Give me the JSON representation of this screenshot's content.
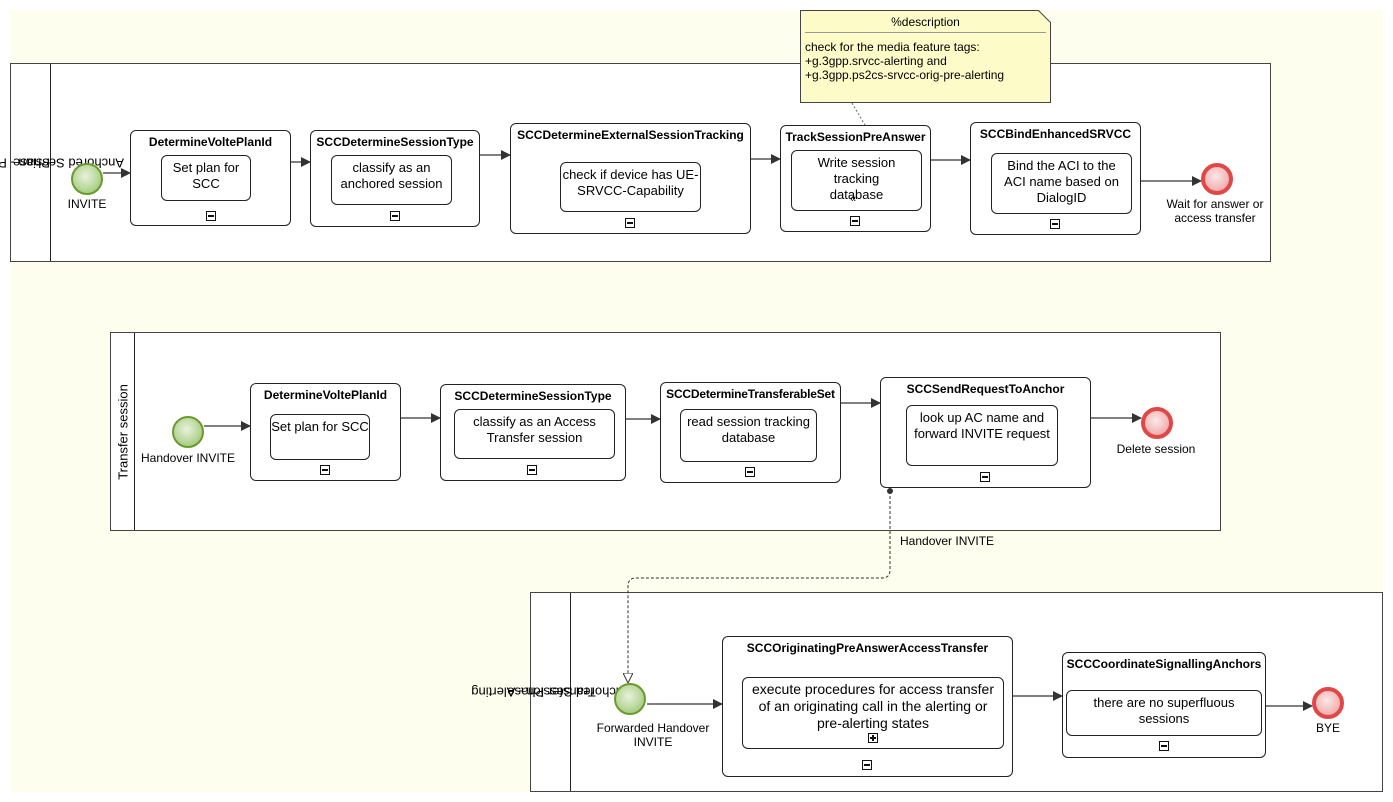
{
  "diagram": {
    "type": "BPMN process diagram",
    "annotation": {
      "title": "%description",
      "body": "check for the media feature tags:\n+g.3gpp.srvcc-alerting and\n+g.3gpp.ps2cs-srvcc-orig-pre-alerting"
    },
    "pools": [
      {
        "label": "Anchored Session - Pre-Answer Phase",
        "label_lines": [
          "Anchored Session - Pre-Answer",
          "Phase"
        ],
        "start_event": "INVITE",
        "tasks": [
          {
            "title": "DetermineVoltePlanId",
            "text": "Set plan for SCC"
          },
          {
            "title": "SCCDetermineSessionType",
            "text": "classify as an anchored session"
          },
          {
            "title": "SCCDetermineExternalSessionTracking",
            "text": "check if device has UE-SRVCC-Capability"
          },
          {
            "title": "TrackSessionPreAnswer",
            "text": "Write session tracking database",
            "marker": "compensation"
          },
          {
            "title": "SCCBindEnhancedSRVCC",
            "text": "Bind the ACI to the ACI name based on DialogID"
          }
        ],
        "end_event": "Wait for answer or access transfer"
      },
      {
        "label": "Transfer session",
        "start_event": "Handover INVITE",
        "tasks": [
          {
            "title": "DetermineVoltePlanId",
            "text": "Set plan for SCC"
          },
          {
            "title": "SCCDetermineSessionType",
            "text": "classify as an Access Transfer session"
          },
          {
            "title": "SCCDetermineTransferableSet",
            "text": "read session tracking database"
          },
          {
            "title": "SCCSendRequestToAnchor",
            "text": "look up AC name and forward INVITE request"
          }
        ],
        "end_event": "Delete session"
      },
      {
        "label": "Anchored Session - Alerting Transfer Phase",
        "label_lines": [
          "Anchored Session - Alerting",
          "Transfer Phase"
        ],
        "start_event": "Forwarded Handover INVITE",
        "tasks": [
          {
            "title": "SCCOriginatingPreAnswerAccessTransfer",
            "text": "execute procedures for access transfer of an originating call in the alerting or pre-alerting states",
            "inner_marker": "expand"
          },
          {
            "title": "SCCCoordinateSignallingAnchors",
            "text": "there are no superfluous sessions"
          }
        ],
        "end_event": "BYE"
      }
    ],
    "message_flow": {
      "label": "Handover INVITE",
      "from": "SCCSendRequestToAnchor",
      "to": "Forwarded Handover INVITE"
    },
    "colors": {
      "canvas": "#fefeef",
      "start_event": "#8fbd62",
      "end_event": "#e04848",
      "annotation": "#fdfbc8"
    }
  }
}
